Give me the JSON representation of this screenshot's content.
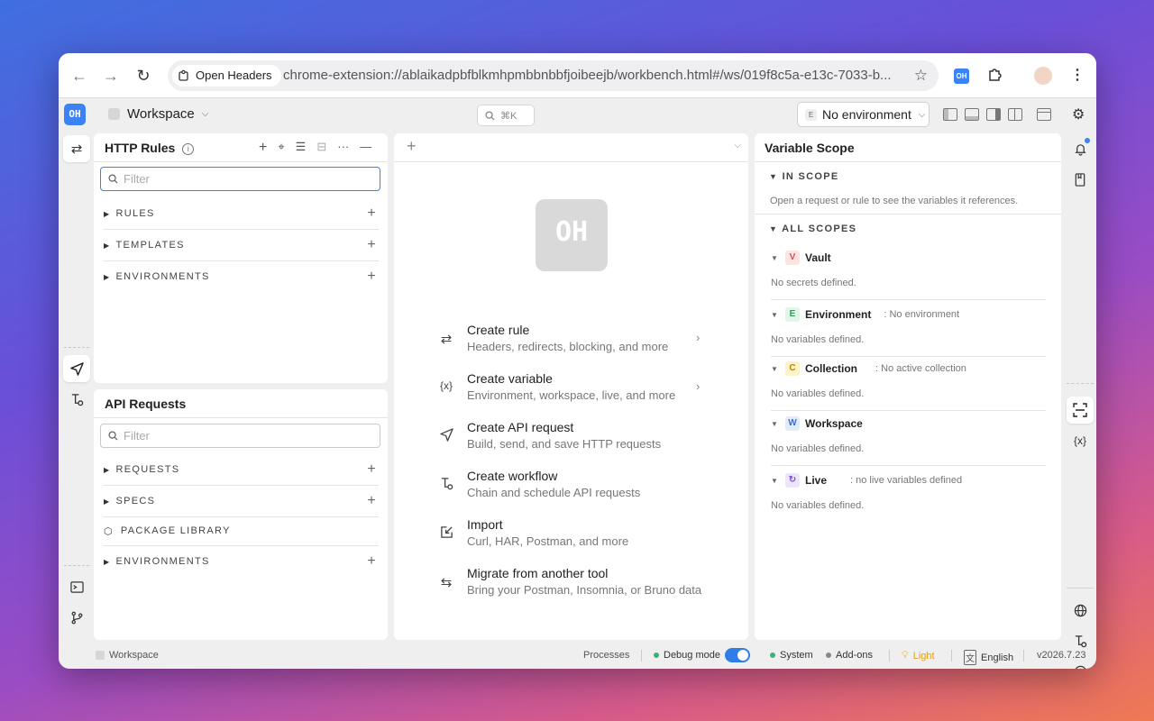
{
  "browser": {
    "site_chip": "Open Headers",
    "url": "chrome-extension://ablaikadpbfblkmhpmbbnbbfjoibeejb/workbench.html#/ws/019f8c5a-e13c-7033-b..."
  },
  "app": {
    "logo_text": "OH",
    "workspace_label": "Workspace",
    "search_shortcut": "⌘K",
    "environment_badge": "E",
    "environment_label": "No environment"
  },
  "http_rules": {
    "title": "HTTP Rules",
    "filter_placeholder": "Filter",
    "sections": [
      "RULES",
      "TEMPLATES",
      "ENVIRONMENTS"
    ]
  },
  "api_requests": {
    "title": "API Requests",
    "filter_placeholder": "Filter",
    "sections": [
      "REQUESTS",
      "SPECS",
      "PACKAGE LIBRARY",
      "ENVIRONMENTS"
    ]
  },
  "center": {
    "logo_text": "OH",
    "actions": [
      {
        "title": "Create rule",
        "subtitle": "Headers, redirects, blocking, and more"
      },
      {
        "title": "Create variable",
        "subtitle": "Environment, workspace, live, and more"
      },
      {
        "title": "Create API request",
        "subtitle": "Build, send, and save HTTP requests"
      },
      {
        "title": "Create workflow",
        "subtitle": "Chain and schedule API requests"
      },
      {
        "title": "Import",
        "subtitle": "Curl, HAR, Postman, and more"
      },
      {
        "title": "Migrate from another tool",
        "subtitle": "Bring your Postman, Insomnia, or Bruno data"
      }
    ]
  },
  "variable_scope": {
    "title": "Variable Scope",
    "in_scope_label": "IN SCOPE",
    "in_scope_hint": "Open a request or rule to see the variables it references.",
    "all_scopes_label": "ALL SCOPES",
    "scopes": [
      {
        "badge": "V",
        "name": "Vault",
        "note": "",
        "empty": "No secrets defined.",
        "color": "#d9534f",
        "bg": "#fde3e3"
      },
      {
        "badge": "E",
        "name": "Environment",
        "note": ": No environment",
        "empty": "No variables defined.",
        "color": "#2e9e5b",
        "bg": "#e1f5e8"
      },
      {
        "badge": "C",
        "name": "Collection",
        "note": ": No active collection",
        "empty": "No variables defined.",
        "color": "#b8860b",
        "bg": "#fdf3c8"
      },
      {
        "badge": "W",
        "name": "Workspace",
        "note": "",
        "empty": "No variables defined.",
        "color": "#3b6fd6",
        "bg": "#e2ebfb"
      },
      {
        "badge": "↻",
        "name": "Live",
        "note": ": no live variables defined",
        "empty": "No variables defined.",
        "color": "#7b4fd6",
        "bg": "#ede5fb"
      }
    ]
  },
  "status_bar": {
    "workspace": "Workspace",
    "processes": "Processes",
    "debug_mode": "Debug mode",
    "system": "System",
    "addons": "Add-ons",
    "theme": "Light",
    "language": "English",
    "version": "v2026.7.23"
  },
  "colors": {
    "accent": "#3b82f6",
    "green_dot": "#3cb371",
    "theme_orange": "#e0a020"
  }
}
